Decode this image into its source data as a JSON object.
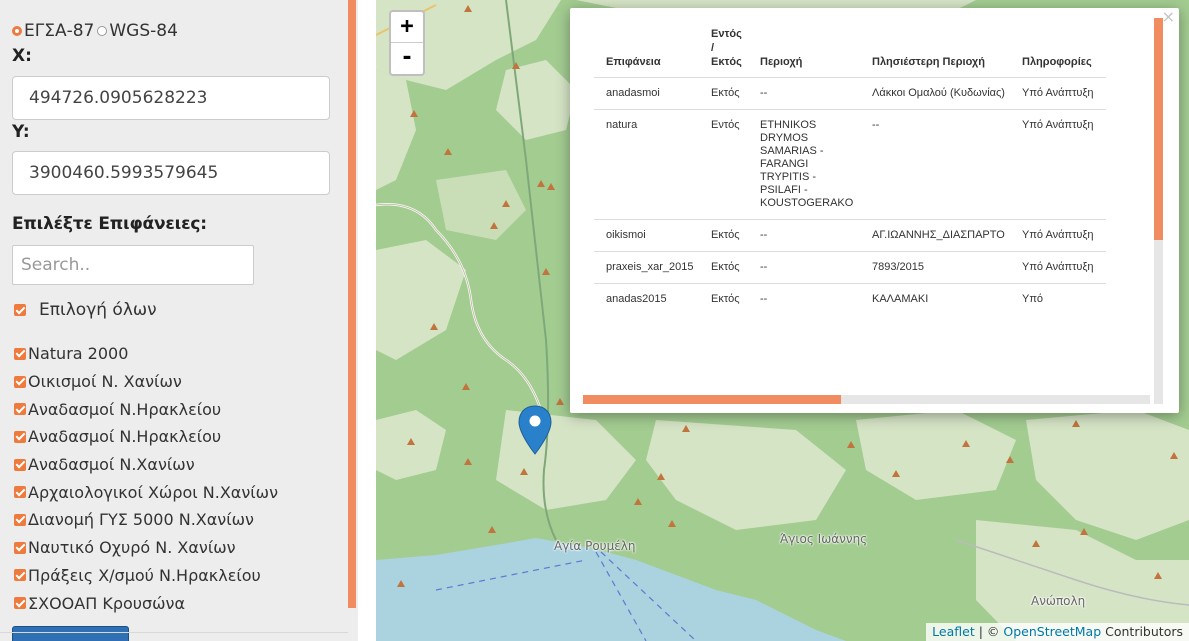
{
  "crs": {
    "option1": "ΕΓΣΑ-87",
    "option2": "WGS-84",
    "selected": "ΕΓΣΑ-87"
  },
  "coords": {
    "x_label": "X:",
    "x_value": "494726.0905628223",
    "y_label": "Y:",
    "y_value": "3900460.5993579645"
  },
  "surfaces": {
    "heading": "Επιλέξτε Επιφάνειες:",
    "search_placeholder": "Search..",
    "select_all_label": "Επιλογή όλων",
    "layers": [
      "Natura 2000",
      "Οικισμοί Ν. Χανίων",
      "Αναδασμοί Ν.Ηρακλείου",
      "Αναδασμοί Ν.Ηρακλείου",
      "Αναδασμοί Ν.Χανίων",
      "Αρχαιολογικοί Χώροι Ν.Χανίων",
      "Διανομή ΓΥΣ 5000 Ν.Χανίων",
      "Ναυτικό Οχυρό Ν. Χανίων",
      "Πράξεις Χ/σμού Ν.Ηρακλείου",
      "ΣΧΟΟΑΠ Κρουσώνα"
    ]
  },
  "map": {
    "zoom_in": "+",
    "zoom_out": "-",
    "places": {
      "agia_roumeli": "Αγία Ρουμέλη",
      "agios_ioannis": "Άγιος Ιωάννης",
      "anopoli": "Ανώπολη"
    },
    "attribution": {
      "leaflet": "Leaflet",
      "separator": "| ©",
      "osm": "OpenStreetMap",
      "contributors": "Contributors"
    }
  },
  "popup": {
    "close": "×",
    "headers": {
      "surface": "Επιφάνεια",
      "in_out_1": "Εντός",
      "in_out_2": "/",
      "in_out_3": "Εκτός",
      "area": "Περιοχή",
      "nearest": "Πλησιέστερη Περιοχή",
      "info": "Πληροφορίες"
    },
    "rows": [
      {
        "surface": "anadasmoi",
        "in_out": "Εκτός",
        "area": "--",
        "nearest": "Λάκκοι Ομαλού (Κυδωνίας)",
        "info": "Υπό Ανάπτυξη"
      },
      {
        "surface": "natura",
        "in_out": "Εντός",
        "area": "ETHNIKOS DRYMOS SAMARIAS - FARANGI TRYPITIS - PSILAFI - KOUSTOGERAKO",
        "nearest": "--",
        "info": "Υπό Ανάπτυξη"
      },
      {
        "surface": "oikismoi",
        "in_out": "Εκτός",
        "area": "--",
        "nearest": "ΑΓ.ΙΩΑΝΝΗΣ_ΔΙΑΣΠΑΡΤΟ",
        "info": "Υπό Ανάπτυξη"
      },
      {
        "surface": "praxeis_xar_2015",
        "in_out": "Εκτός",
        "area": "--",
        "nearest": "7893/2015",
        "info": "Υπό Ανάπτυξη"
      },
      {
        "surface": "anadas2015",
        "in_out": "Εκτός",
        "area": "--",
        "nearest": "ΚΑΛΑΜΑΚΙ",
        "info": "Υπό"
      }
    ]
  },
  "colors": {
    "accent": "#ef7a3d",
    "scroll_thumb": "#f08c5f",
    "forest": "#9fca8f",
    "meadow": "#d3e3c3",
    "sea": "#aad3df",
    "link": "#0078a8"
  }
}
